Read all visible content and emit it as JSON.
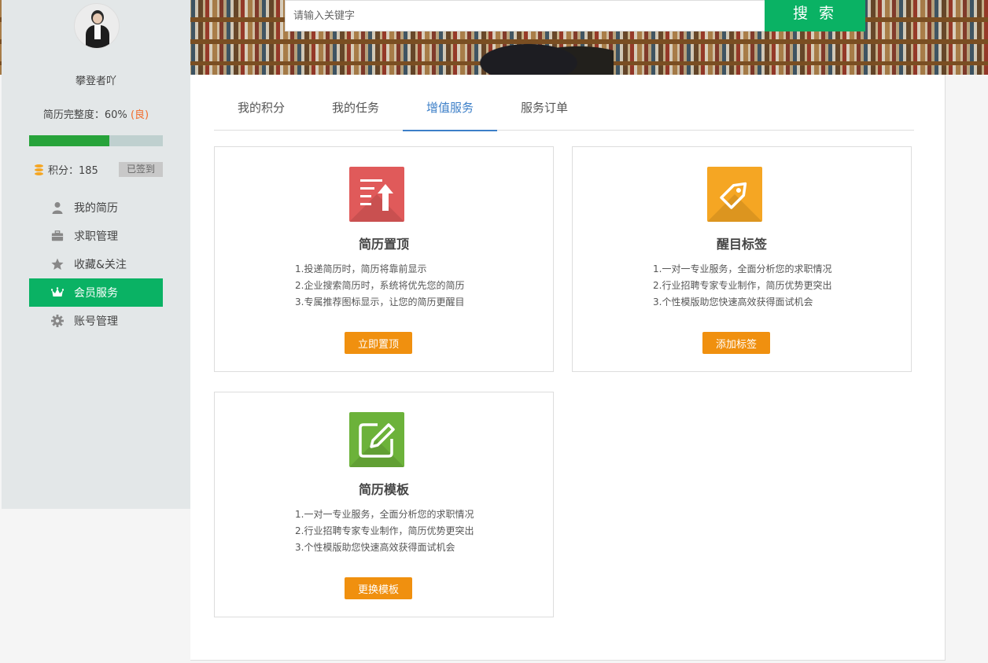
{
  "search": {
    "placeholder": "请输入关键字",
    "button_label": "搜 索"
  },
  "profile": {
    "username": "攀登者吖",
    "completeness_label": "简历完整度：60%",
    "completeness_grade": "(良)",
    "completeness_value": 0.6,
    "points_label": "积分：185",
    "signin_status": "已签到"
  },
  "sidebar": {
    "items": [
      {
        "label": "我的简历",
        "icon": "user-icon",
        "active": false
      },
      {
        "label": "求职管理",
        "icon": "briefcase-icon",
        "active": false
      },
      {
        "label": "收藏&关注",
        "icon": "star-icon",
        "active": false
      },
      {
        "label": "会员服务",
        "icon": "crown-icon",
        "active": true
      },
      {
        "label": "账号管理",
        "icon": "gear-icon",
        "active": false
      }
    ]
  },
  "tabs": [
    {
      "label": "我的积分",
      "active": false
    },
    {
      "label": "我的任务",
      "active": false
    },
    {
      "label": "增值服务",
      "active": true
    },
    {
      "label": "服务订单",
      "active": false
    }
  ],
  "colors": {
    "brand_green": "#0ab264",
    "action_orange": "#f0900f",
    "tab_active_blue": "#3c7fc8",
    "grade_orange": "#f26b2a"
  },
  "services": [
    {
      "title": "简历置顶",
      "icon": "resume-top-icon",
      "icon_color": "#e05a5a",
      "lines": [
        "1.投递简历时，简历将靠前显示",
        "2.企业搜索简历时，系统将优先您的简历",
        "3.专属推荐图标显示，让您的简历更醒目"
      ],
      "button_label": "立即置顶"
    },
    {
      "title": "醒目标签",
      "icon": "tag-icon",
      "icon_color": "#f5a623",
      "lines": [
        "1.一对一专业服务，全面分析您的求职情况",
        "2.行业招聘专家专业制作，简历优势更突出",
        "3.个性模版助您快速高效获得面试机会"
      ],
      "button_label": "添加标签"
    },
    {
      "title": "简历模板",
      "icon": "edit-icon",
      "icon_color": "#6cb23a",
      "lines": [
        "1.一对一专业服务，全面分析您的求职情况",
        "2.行业招聘专家专业制作，简历优势更突出",
        "3.个性模版助您快速高效获得面试机会"
      ],
      "button_label": "更换模板"
    }
  ]
}
